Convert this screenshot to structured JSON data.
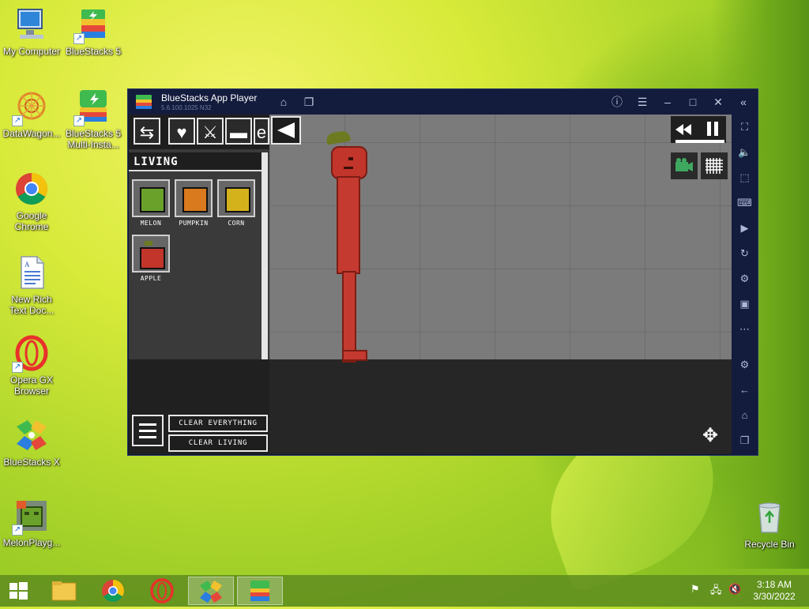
{
  "desktop": {
    "icons": [
      {
        "label": "My Computer",
        "icon": "computer-icon"
      },
      {
        "label": "BlueStacks 5",
        "icon": "bluestacks-icon"
      },
      {
        "label": "DataWagon...",
        "icon": "datawagon-icon"
      },
      {
        "label": "BlueStacks 5\nMulti-Insta...",
        "icon": "bluestacks-multi-icon"
      },
      {
        "label": "Google\nChrome",
        "icon": "chrome-icon"
      },
      {
        "label": "New Rich\nText Doc...",
        "icon": "document-icon"
      },
      {
        "label": "Opera GX\nBrowser",
        "icon": "opera-icon"
      },
      {
        "label": "BlueStacks X",
        "icon": "bluestacks-x-icon"
      },
      {
        "label": "MelonPlayg...",
        "icon": "melon-playground-icon"
      },
      {
        "label": "Recycle Bin",
        "icon": "recycle-bin-icon"
      }
    ]
  },
  "window": {
    "title": "BlueStacks App Player",
    "version": "5.6.100.1025 N32"
  },
  "game": {
    "category": "LIVING",
    "items": [
      {
        "name": "MELON",
        "color": "#6aa12a"
      },
      {
        "name": "PUMPKIN",
        "color": "#d97a1e"
      },
      {
        "name": "CORN",
        "color": "#d4b21c"
      },
      {
        "name": "APPLE",
        "color": "#c2352b"
      }
    ],
    "clear_everything": "CLEAR EVERYTHING",
    "clear_living": "CLEAR LIVING"
  },
  "taskbar": {
    "time": "3:18 AM",
    "date": "3/30/2022"
  }
}
